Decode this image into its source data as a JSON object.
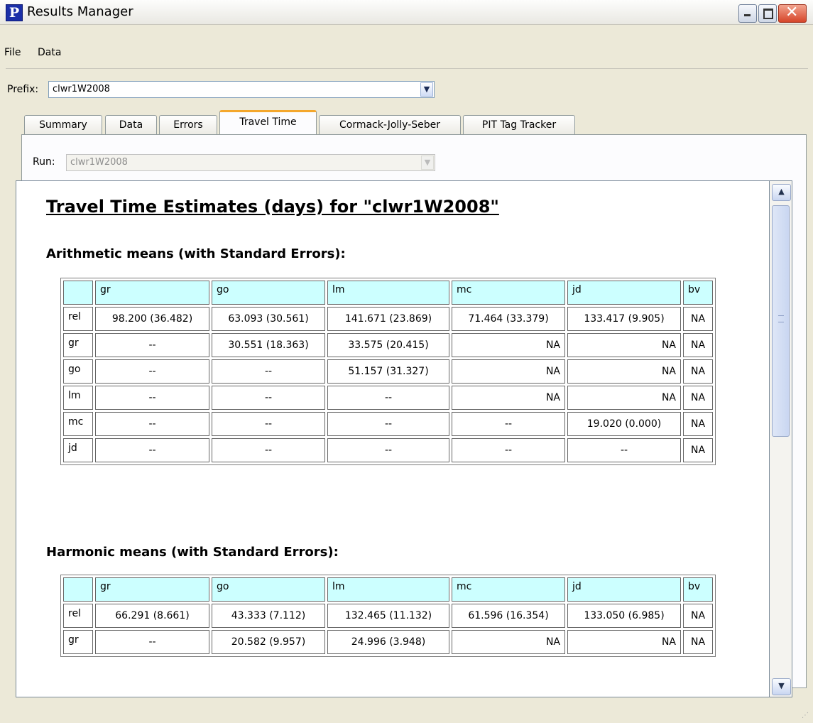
{
  "window": {
    "title": "Results Manager",
    "app_icon": "P"
  },
  "menu": [
    "File",
    "Data"
  ],
  "prefix": {
    "label": "Prefix:",
    "value": "clwr1W2008"
  },
  "tabs": [
    "Summary",
    "Data",
    "Errors",
    "Travel Time",
    "Cormack-Jolly-Seber",
    "PIT Tag Tracker"
  ],
  "active_tab": "Travel Time",
  "run": {
    "label": "Run:",
    "value": "clwr1W2008"
  },
  "report": {
    "heading": "Travel Time Estimates (days) for \"clwr1W2008\"",
    "sections": [
      {
        "title": "Arithmetic means (with Standard Errors):",
        "columns": [
          "",
          "gr",
          "go",
          "lm",
          "mc",
          "jd",
          "bv"
        ],
        "rows": [
          [
            "rel",
            "98.200 (36.482)",
            "63.093 (30.561)",
            "141.671 (23.869)",
            "71.464 (33.379)",
            "133.417 (9.905)",
            "NA"
          ],
          [
            "gr",
            "--",
            "30.551 (18.363)",
            "33.575 (20.415)",
            "NA",
            "NA",
            "NA"
          ],
          [
            "go",
            "--",
            "--",
            "51.157 (31.327)",
            "NA",
            "NA",
            "NA"
          ],
          [
            "lm",
            "--",
            "--",
            "--",
            "NA",
            "NA",
            "NA"
          ],
          [
            "mc",
            "--",
            "--",
            "--",
            "--",
            "19.020 (0.000)",
            "NA"
          ],
          [
            "jd",
            "--",
            "--",
            "--",
            "--",
            "--",
            "NA"
          ]
        ]
      },
      {
        "title": "Harmonic means (with Standard Errors):",
        "columns": [
          "",
          "gr",
          "go",
          "lm",
          "mc",
          "jd",
          "bv"
        ],
        "rows": [
          [
            "rel",
            "66.291 (8.661)",
            "43.333 (7.112)",
            "132.465 (11.132)",
            "61.596 (16.354)",
            "133.050 (6.985)",
            "NA"
          ],
          [
            "gr",
            "--",
            "20.582 (9.957)",
            "24.996 (3.948)",
            "NA",
            "NA",
            "NA"
          ]
        ]
      }
    ]
  }
}
